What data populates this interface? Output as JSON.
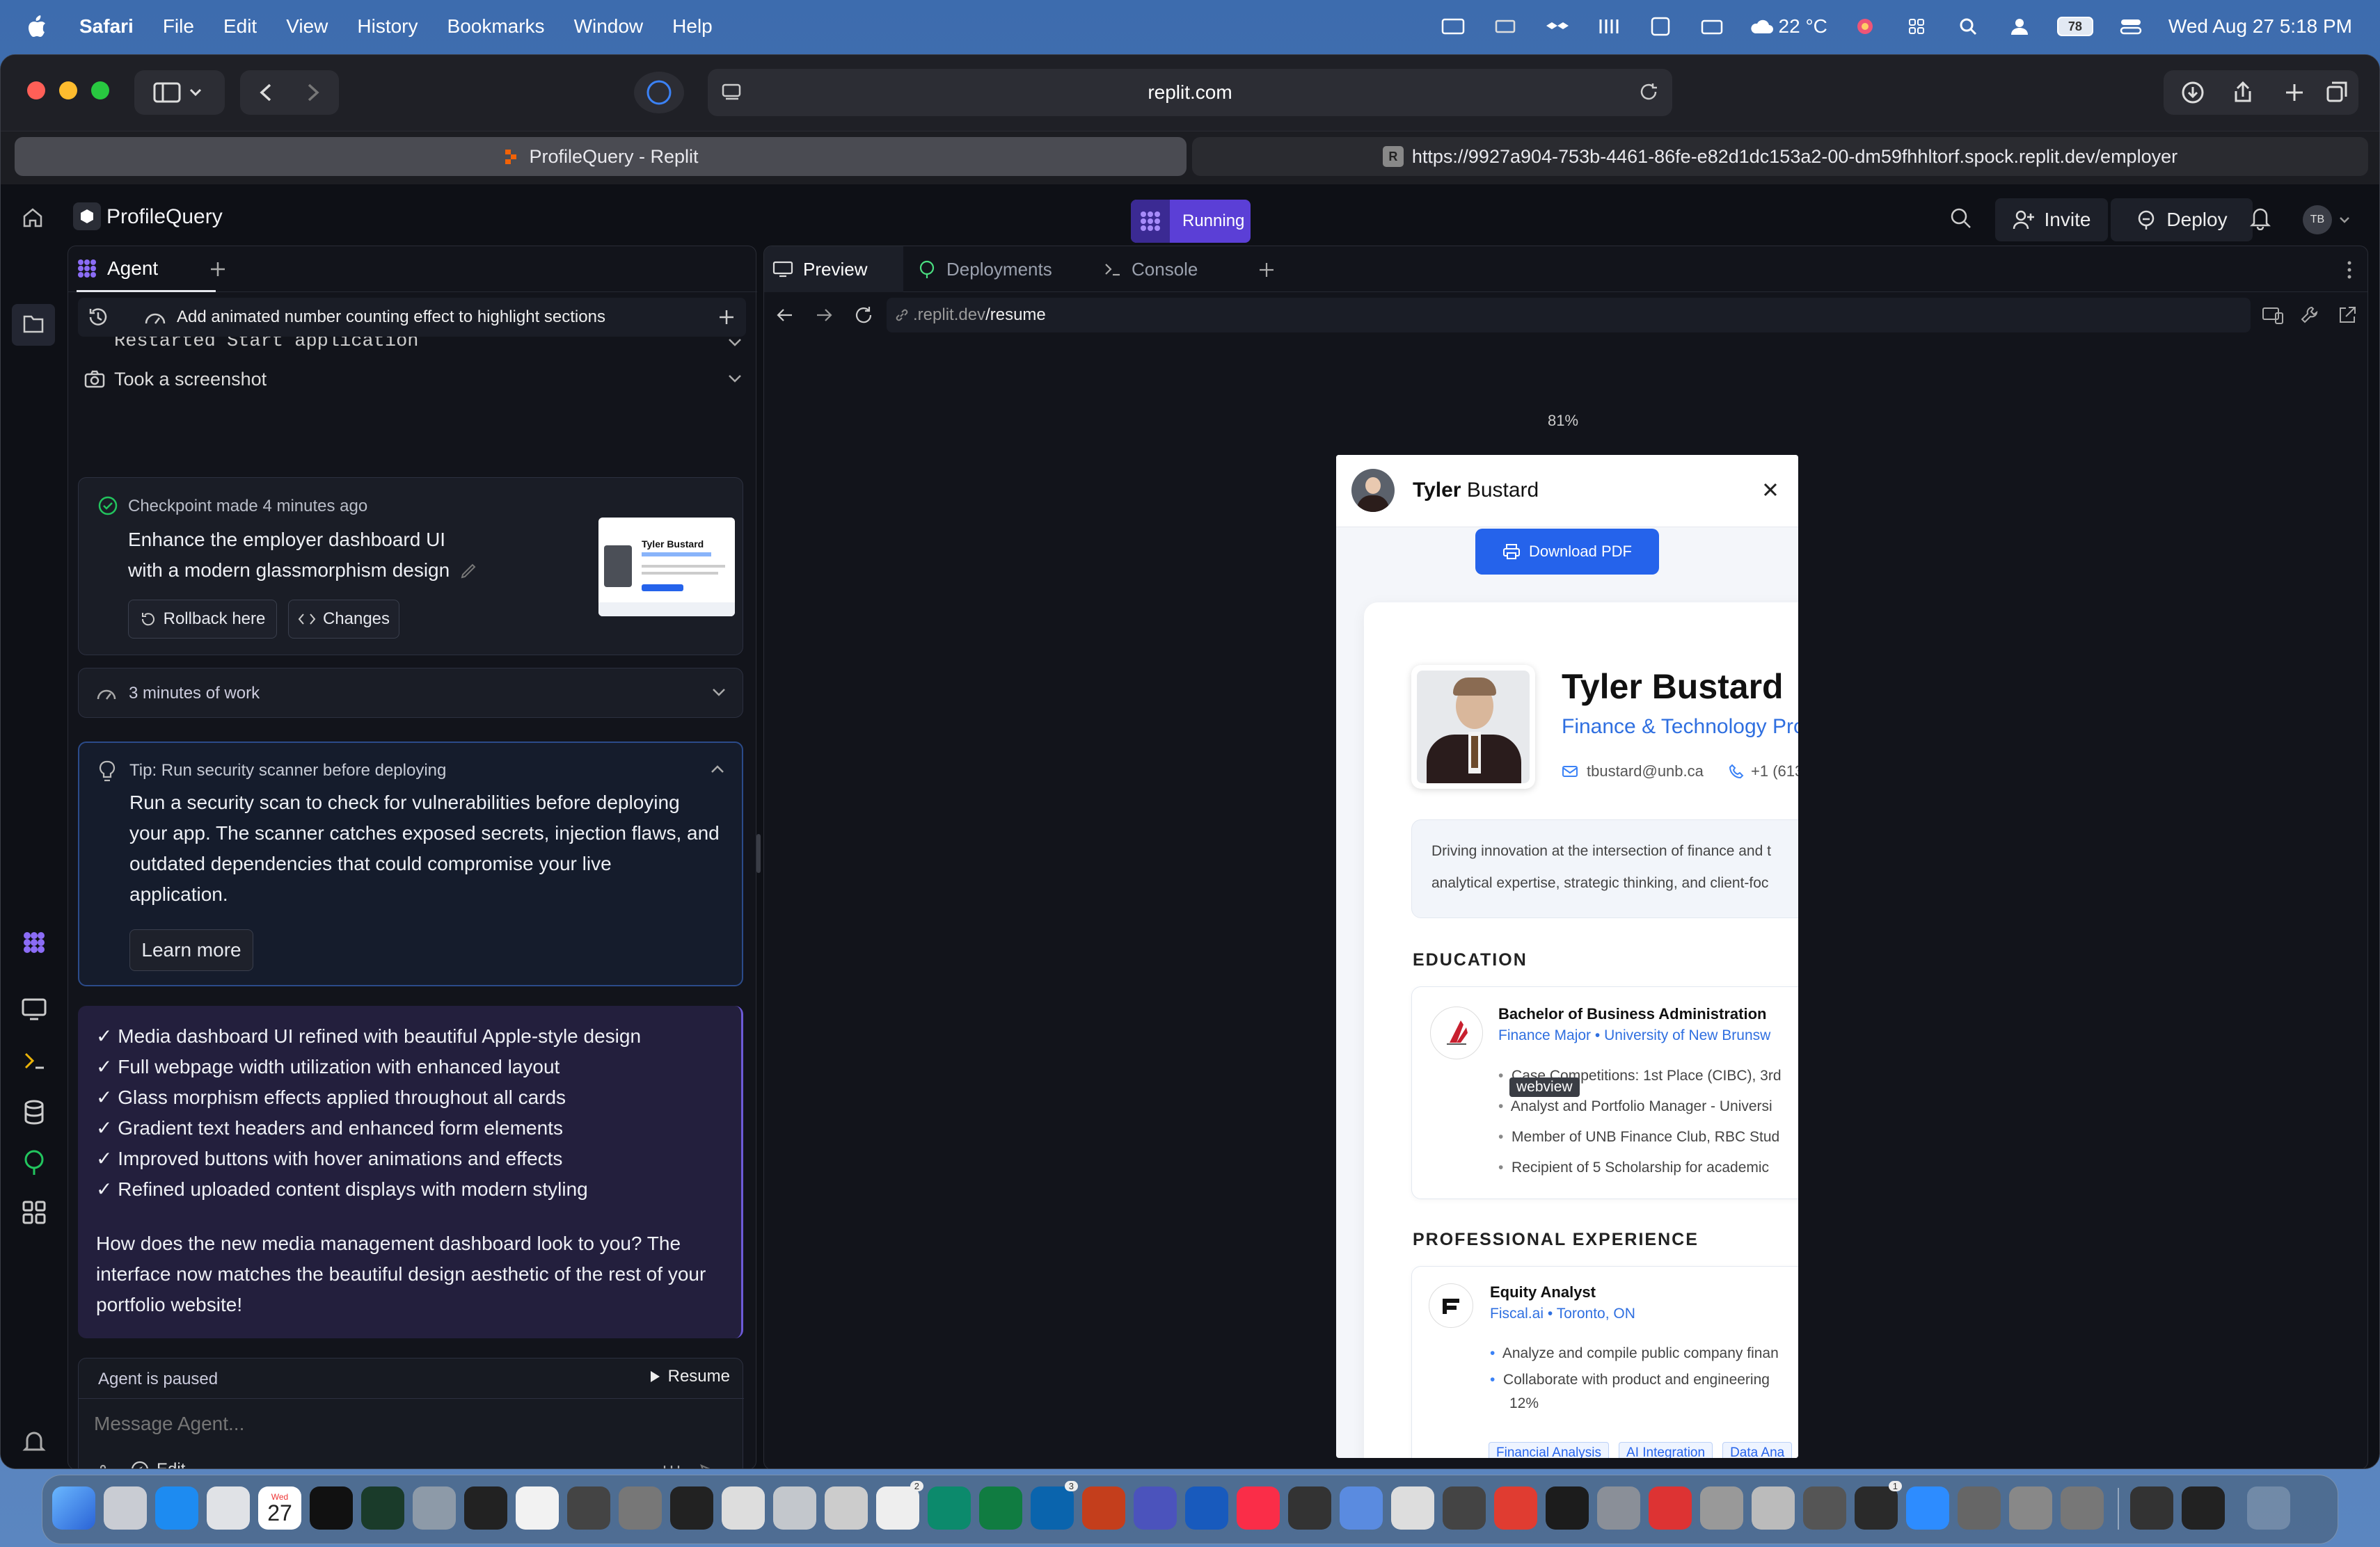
{
  "menubar": {
    "app": "Safari",
    "items": [
      "File",
      "Edit",
      "View",
      "History",
      "Bookmarks",
      "Window",
      "Help"
    ],
    "weather": "22 °C",
    "battery": "78",
    "datetime": "Wed Aug 27  5:18 PM"
  },
  "browser": {
    "address": "replit.com",
    "tab1_title": "ProfileQuery - Replit",
    "tab2_url": "https://9927a904-753b-4461-86fe-e82d1dc153a2-00-dm59fhhltorf.spock.replit.dev/employer",
    "tab2_badge": "R"
  },
  "appbar": {
    "project": "ProfileQuery",
    "status": "Running",
    "invite": "Invite",
    "deploy": "Deploy",
    "avatar": "TB"
  },
  "agent": {
    "tab_label": "Agent",
    "task_title": "Add animated number counting effect to highlight sections",
    "log1": "Restarted Start application",
    "log2": "Took a screenshot",
    "checkpoint_label": "Checkpoint made 4 minutes ago",
    "checkpoint_text_1": "Enhance the employer dashboard UI",
    "checkpoint_text_2": "with a modern glassmorphism design",
    "rollback": "Rollback here",
    "changes": "Changes",
    "thumb_name": "Tyler Bustard",
    "work": "3 minutes of work",
    "tip_title": "Tip: Run security scanner before deploying",
    "tip_lines": [
      "Run a security scan to check for vulnerabilities before deploying",
      "your app. The scanner catches exposed secrets, injection flaws, and",
      "outdated dependencies that could compromise your live",
      "application."
    ],
    "learn_more": "Learn more",
    "checklist": [
      "✓ Media dashboard UI refined with beautiful Apple-style design",
      "✓ Full webpage width utilization with enhanced layout",
      "✓ Glass morphism effects applied throughout all cards",
      "✓ Gradient text headers and enhanced form elements",
      "✓ Improved buttons with hover animations and effects",
      "✓ Refined uploaded content displays with modern styling"
    ],
    "question_lines": [
      "How does the new media management dashboard look to you? The",
      "interface now matches the beautiful design aesthetic of the rest of your",
      "portfolio website!"
    ],
    "paused": "Agent is paused",
    "resume": "Resume",
    "placeholder": "Message Agent...",
    "edit": "Edit"
  },
  "preview": {
    "tabs": [
      "Preview",
      "Deployments",
      "Console"
    ],
    "url_prefix": ".replit.dev",
    "url_path": "/resume",
    "zoom": "81%"
  },
  "resume": {
    "header_first": "Tyler",
    "header_last": "Bustard",
    "download": "Download PDF",
    "name": "Tyler Bustard",
    "role": "Finance & Technology Prof",
    "email": "tbustard@unb.ca",
    "phone": "+1 (613",
    "summary_1": "Driving innovation at the intersection of finance and t",
    "summary_2": "analytical expertise, strategic thinking, and client-foc",
    "education_heading": "EDUCATION",
    "degree": "Bachelor of Business Administration",
    "school_major": "Finance Major",
    "school_name": "University of New Brunsw",
    "edu_bullets": [
      "Case Competitions: 1st Place (CIBC), 3rd",
      "Analyst and Portfolio Manager - Universi",
      "Member of UNB Finance Club, RBC Stud",
      "Recipient of 5 Scholarship for academic"
    ],
    "tooltip": "webview",
    "exp_heading": "PROFESSIONAL EXPERIENCE",
    "job_title": "Equity Analyst",
    "company": "Fiscal.ai",
    "location": "Toronto, ON",
    "exp_bullets": [
      "Analyze and compile public company finan",
      "Collaborate with product and engineering"
    ],
    "exp_bullet_cont": "12%",
    "tags": [
      "Financial Analysis",
      "AI Integration",
      "Data Ana"
    ]
  },
  "dock": {
    "calendar_day": "27",
    "calendar_month": "Wed",
    "badges": [
      "2",
      "3",
      "1"
    ]
  }
}
